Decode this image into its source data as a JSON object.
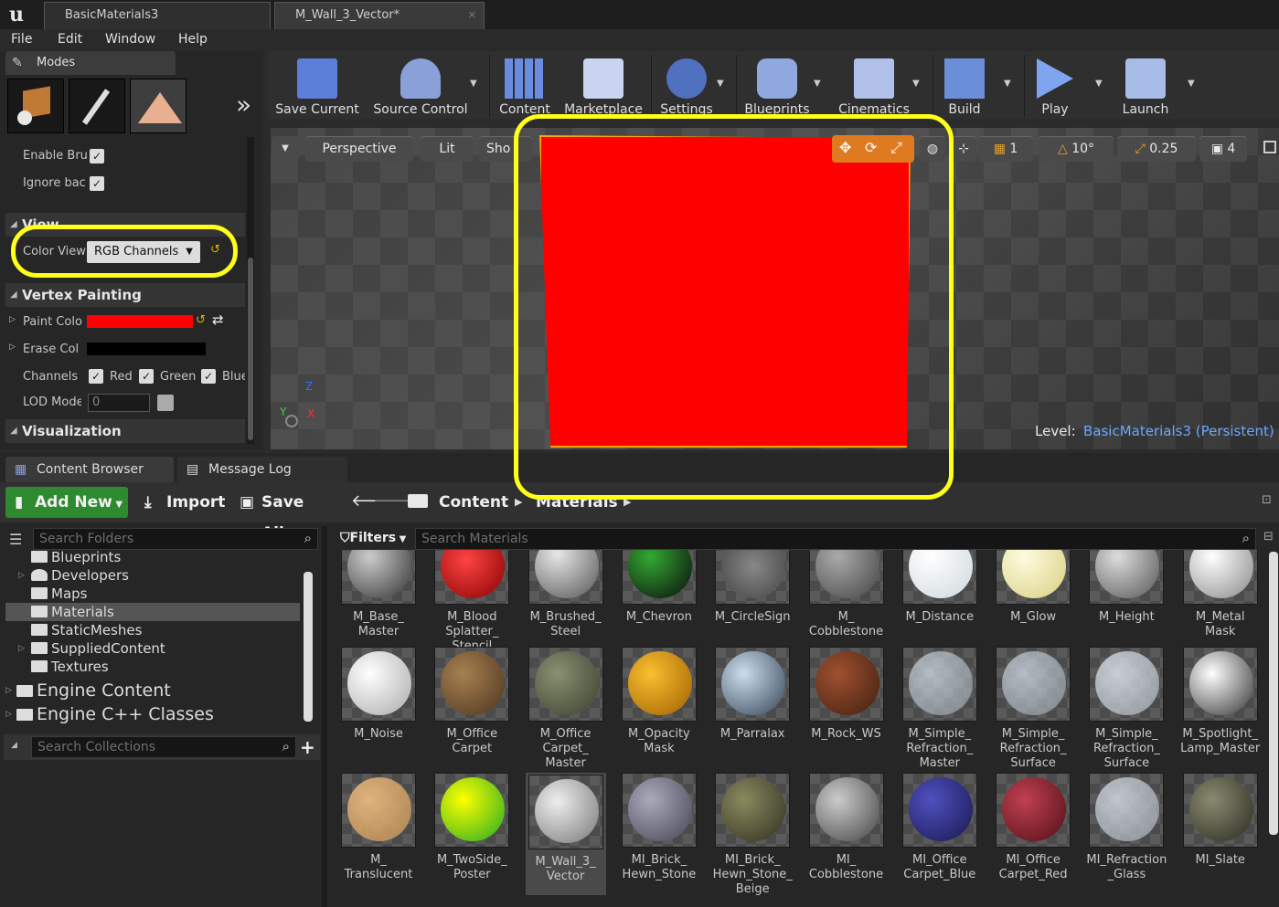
{
  "window": {
    "tabs": [
      {
        "label": "BasicMaterials3"
      },
      {
        "label": "M_Wall_3_Vector*"
      }
    ]
  },
  "menu": [
    "File",
    "Edit",
    "Window",
    "Help"
  ],
  "modes": {
    "tab_label": "Modes"
  },
  "properties": {
    "enable_brush": "Enable Bru",
    "ignore_back": "Ignore bac",
    "view_section": "View",
    "color_view_label": "Color View",
    "color_view_value": "RGB Channels",
    "vertex_painting": "Vertex Painting",
    "paint_color": "Paint Colo",
    "erase_color": "Erase Col",
    "channels_label": "Channels",
    "ch_red": "Red",
    "ch_green": "Green",
    "ch_blue": "Blue",
    "lod_label": "LOD Mode",
    "lod_value": "0",
    "visualization": "Visualization",
    "paint_color_hex": "#ff0000",
    "erase_color_hex": "#000000"
  },
  "toolbar": [
    {
      "label": "Save Current"
    },
    {
      "label": "Source Control"
    },
    {
      "label": "Content"
    },
    {
      "label": "Marketplace"
    },
    {
      "label": "Settings"
    },
    {
      "label": "Blueprints"
    },
    {
      "label": "Cinematics"
    },
    {
      "label": "Build"
    },
    {
      "label": "Play"
    },
    {
      "label": "Launch"
    }
  ],
  "viewport": {
    "perspective": "Perspective",
    "lit": "Lit",
    "show": "Sho",
    "grid_snap": "1",
    "rot_snap": "10°",
    "scale_snap": "0.25",
    "cam_speed": "4",
    "level_label": "Level:",
    "level_value": "BasicMaterials3 (Persistent)",
    "axis_z": "Z",
    "axis_y": "Y",
    "axis_x": "X",
    "wall_color": "#ff0000"
  },
  "bottom_tabs": [
    {
      "label": "Content Browser"
    },
    {
      "label": "Message Log"
    }
  ],
  "cb": {
    "add_new": "Add New",
    "import": "Import",
    "save_all": "Save All",
    "crumb_root": "Content",
    "crumb_current": "Materials",
    "search_folders": "Search Folders",
    "filters": "Filters",
    "search_materials": "Search Materials",
    "search_collections": "Search Collections",
    "folders": [
      "Blueprints",
      "Developers",
      "Maps",
      "Materials",
      "StaticMeshes",
      "SuppliedContent",
      "Textures"
    ],
    "engine_content": "Engine Content",
    "engine_cpp": "Engine C++ Classes"
  },
  "assets": [
    [
      "M_Base_\nMaster",
      "M_Blood\nSplatter_\nStencil",
      "M_Brushed_\nSteel",
      "M_Chevron",
      "M_CircleSign",
      "M_\nCobblestone",
      "M_Distance",
      "M_Glow",
      "M_Height",
      "M_Metal\nMask"
    ],
    [
      "M_Noise",
      "M_Office\nCarpet",
      "M_Office\nCarpet_\nMaster",
      "M_Opacity\nMask",
      "M_Parralax",
      "M_Rock_WS",
      "M_Simple_\nRefraction_\nMaster",
      "M_Simple_\nRefraction_\nSurface",
      "M_Simple_\nRefraction_\nSurface",
      "M_Spotlight_\nLamp_Master"
    ],
    [
      "M_\nTranslucent",
      "M_TwoSide_\nPoster",
      "M_Wall_3_\nVector",
      "MI_Brick_\nHewn_Stone",
      "MI_Brick_\nHewn_Stone_\nBeige",
      "MI_\nCobblestone",
      "MI_Office\nCarpet_Blue",
      "MI_Office\nCarpet_Red",
      "MI_Refraction\n_Glass",
      "MI_Slate"
    ]
  ]
}
